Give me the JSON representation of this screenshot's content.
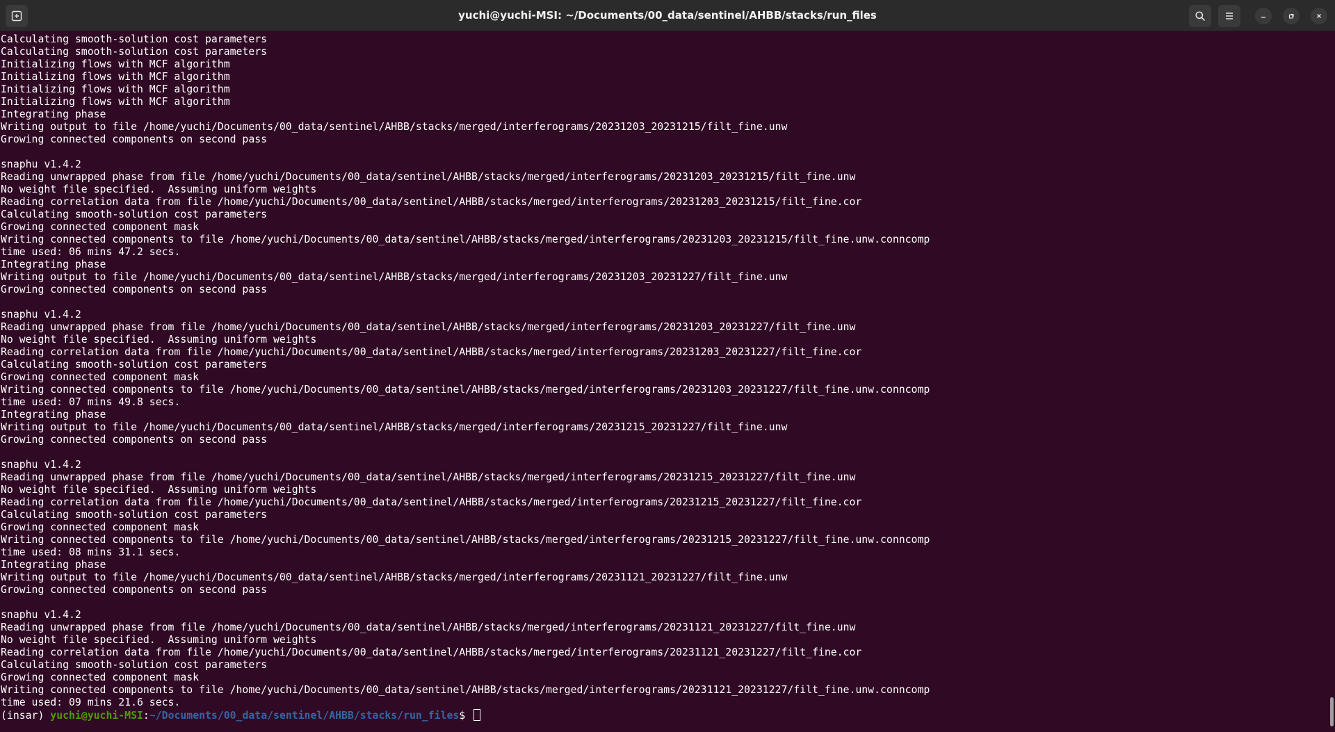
{
  "window": {
    "title": "yuchi@yuchi-MSI: ~/Documents/00_data/sentinel/AHBB/stacks/run_files"
  },
  "toolbar": {
    "new_tab_icon": "new-tab-icon",
    "search_icon": "search-icon",
    "menu_icon": "hamburger-menu-icon",
    "minimize_icon": "minimize-icon",
    "maximize_icon": "maximize-icon",
    "close_icon": "close-icon"
  },
  "terminal": {
    "output_lines": [
      "Calculating smooth-solution cost parameters",
      "Calculating smooth-solution cost parameters",
      "Initializing flows with MCF algorithm",
      "Initializing flows with MCF algorithm",
      "Initializing flows with MCF algorithm",
      "Initializing flows with MCF algorithm",
      "Integrating phase",
      "Writing output to file /home/yuchi/Documents/00_data/sentinel/AHBB/stacks/merged/interferograms/20231203_20231215/filt_fine.unw",
      "Growing connected components on second pass",
      "",
      "snaphu v1.4.2",
      "Reading unwrapped phase from file /home/yuchi/Documents/00_data/sentinel/AHBB/stacks/merged/interferograms/20231203_20231215/filt_fine.unw",
      "No weight file specified.  Assuming uniform weights",
      "Reading correlation data from file /home/yuchi/Documents/00_data/sentinel/AHBB/stacks/merged/interferograms/20231203_20231215/filt_fine.cor",
      "Calculating smooth-solution cost parameters",
      "Growing connected component mask",
      "Writing connected components to file /home/yuchi/Documents/00_data/sentinel/AHBB/stacks/merged/interferograms/20231203_20231215/filt_fine.unw.conncomp",
      "time used: 06 mins 47.2 secs.",
      "Integrating phase",
      "Writing output to file /home/yuchi/Documents/00_data/sentinel/AHBB/stacks/merged/interferograms/20231203_20231227/filt_fine.unw",
      "Growing connected components on second pass",
      "",
      "snaphu v1.4.2",
      "Reading unwrapped phase from file /home/yuchi/Documents/00_data/sentinel/AHBB/stacks/merged/interferograms/20231203_20231227/filt_fine.unw",
      "No weight file specified.  Assuming uniform weights",
      "Reading correlation data from file /home/yuchi/Documents/00_data/sentinel/AHBB/stacks/merged/interferograms/20231203_20231227/filt_fine.cor",
      "Calculating smooth-solution cost parameters",
      "Growing connected component mask",
      "Writing connected components to file /home/yuchi/Documents/00_data/sentinel/AHBB/stacks/merged/interferograms/20231203_20231227/filt_fine.unw.conncomp",
      "time used: 07 mins 49.8 secs.",
      "Integrating phase",
      "Writing output to file /home/yuchi/Documents/00_data/sentinel/AHBB/stacks/merged/interferograms/20231215_20231227/filt_fine.unw",
      "Growing connected components on second pass",
      "",
      "snaphu v1.4.2",
      "Reading unwrapped phase from file /home/yuchi/Documents/00_data/sentinel/AHBB/stacks/merged/interferograms/20231215_20231227/filt_fine.unw",
      "No weight file specified.  Assuming uniform weights",
      "Reading correlation data from file /home/yuchi/Documents/00_data/sentinel/AHBB/stacks/merged/interferograms/20231215_20231227/filt_fine.cor",
      "Calculating smooth-solution cost parameters",
      "Growing connected component mask",
      "Writing connected components to file /home/yuchi/Documents/00_data/sentinel/AHBB/stacks/merged/interferograms/20231215_20231227/filt_fine.unw.conncomp",
      "time used: 08 mins 31.1 secs.",
      "Integrating phase",
      "Writing output to file /home/yuchi/Documents/00_data/sentinel/AHBB/stacks/merged/interferograms/20231121_20231227/filt_fine.unw",
      "Growing connected components on second pass",
      "",
      "snaphu v1.4.2",
      "Reading unwrapped phase from file /home/yuchi/Documents/00_data/sentinel/AHBB/stacks/merged/interferograms/20231121_20231227/filt_fine.unw",
      "No weight file specified.  Assuming uniform weights",
      "Reading correlation data from file /home/yuchi/Documents/00_data/sentinel/AHBB/stacks/merged/interferograms/20231121_20231227/filt_fine.cor",
      "Calculating smooth-solution cost parameters",
      "Growing connected component mask",
      "Writing connected components to file /home/yuchi/Documents/00_data/sentinel/AHBB/stacks/merged/interferograms/20231121_20231227/filt_fine.unw.conncomp",
      "time used: 09 mins 21.6 secs."
    ],
    "prompt": {
      "env": "(insar) ",
      "user_host": "yuchi@yuchi-MSI",
      "separator": ":",
      "path": "~/Documents/00_data/sentinel/AHBB/stacks/run_files",
      "symbol": "$ "
    }
  },
  "colors": {
    "background": "#300a24",
    "titlebar": "#2b2b2b",
    "prompt_user": "#4e9a06",
    "prompt_path": "#3465a4",
    "text": "#ffffff"
  }
}
